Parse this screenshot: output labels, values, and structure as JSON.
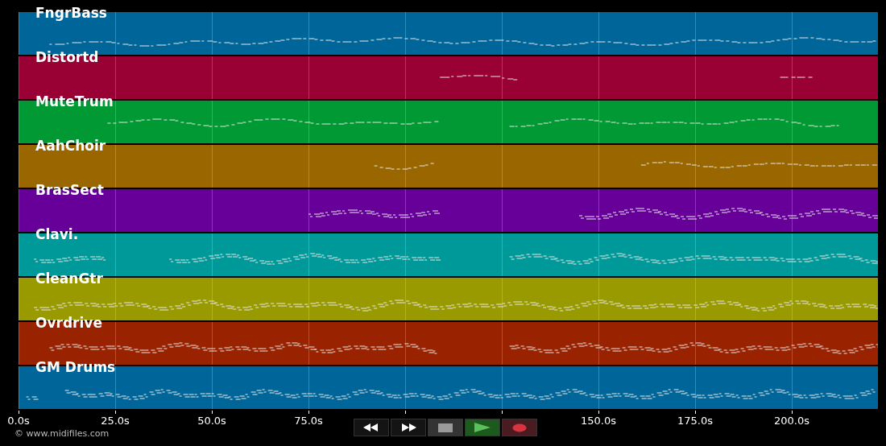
{
  "tracks": [
    {
      "name": "FngrBass",
      "color": "#006699"
    },
    {
      "name": "Distortd",
      "color": "#990033"
    },
    {
      "name": "MuteTrum",
      "color": "#009933"
    },
    {
      "name": "AahChoir",
      "color": "#996600"
    },
    {
      "name": "BrasSect",
      "color": "#660099"
    },
    {
      "name": "Clavi.",
      "color": "#009999"
    },
    {
      "name": "CleanGtr",
      "color": "#999900"
    },
    {
      "name": "Ovrdrive",
      "color": "#992200"
    },
    {
      "name": "GM Drums",
      "color": "#006699"
    }
  ],
  "time_axis": {
    "ticks": [
      {
        "label": "0.0s"
      },
      {
        "label": "25.0s"
      },
      {
        "label": "50.0s"
      },
      {
        "label": "75.0s"
      },
      {
        "covered": true
      },
      {
        "covered": true
      },
      {
        "label": "150.0s"
      },
      {
        "label": "175.0s"
      },
      {
        "label": "200.0s"
      }
    ]
  },
  "transport": [
    {
      "kind": "rewind"
    },
    {
      "kind": "forward"
    },
    {
      "kind": "stop"
    },
    {
      "kind": "play"
    },
    {
      "kind": "record"
    }
  ],
  "copyright": "© www.midifiles.com"
}
